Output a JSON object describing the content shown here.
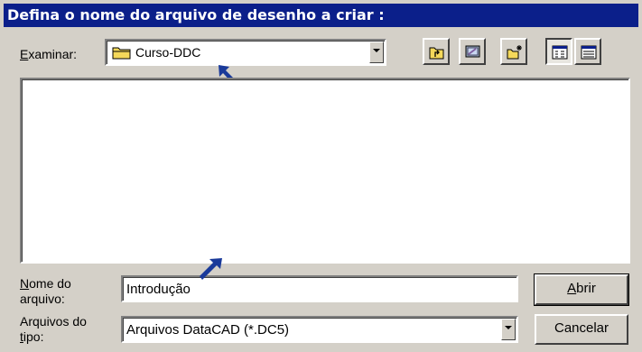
{
  "title": "Defina o nome do arquivo de desenho a criar :",
  "lookin": {
    "label_accel": "E",
    "label_rest": "xaminar:",
    "folder": "Curso-DDC",
    "folder_icon": "folder-icon"
  },
  "toolbar": {
    "buttons": [
      {
        "name": "up-one-level-icon"
      },
      {
        "name": "desktop-icon"
      },
      {
        "name": "new-folder-icon"
      },
      {
        "name": "list-view-icon"
      },
      {
        "name": "details-view-icon"
      }
    ]
  },
  "filename": {
    "label_accel": "N",
    "label_rest": "ome do",
    "label_line2": "arquivo:",
    "value": "Introdução"
  },
  "filetype": {
    "label_line1": "Arquivos do",
    "label_line2_accel": "t",
    "label_line2_rest": "ipo:",
    "value": "Arquivos DataCAD (*.DC5)"
  },
  "buttons": {
    "open_accel": "A",
    "open_rest": "brir",
    "cancel": "Cancelar"
  },
  "colors": {
    "title_bar": "#0b1f8a",
    "face": "#d4d0c8",
    "annotation_arrow": "#1a3a9a"
  }
}
